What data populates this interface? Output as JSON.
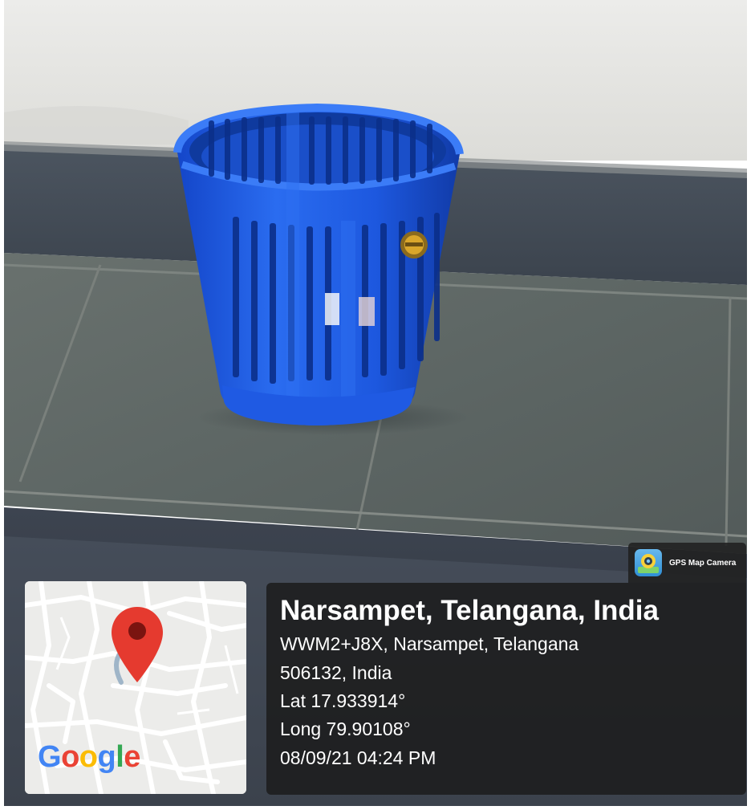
{
  "overlay": {
    "badge_label": "GPS Map Camera",
    "badge_icon": "gps-map-camera-app-icon",
    "title": "Narsampet, Telangana, India",
    "address_line_1": "WWM2+J8X, Narsampet, Telangana",
    "address_line_2": "506132, India",
    "latitude": "Lat 17.933914°",
    "longitude": "Long 79.90108°",
    "datetime": "08/09/21 04:24 PM"
  },
  "map": {
    "logo_letters": [
      {
        "char": "G",
        "color": "#4285F4"
      },
      {
        "char": "o",
        "color": "#EA4335"
      },
      {
        "char": "o",
        "color": "#FBBC05"
      },
      {
        "char": "g",
        "color": "#4285F4"
      },
      {
        "char": "l",
        "color": "#34A853"
      },
      {
        "char": "e",
        "color": "#EA4335"
      }
    ],
    "pin_icon": "map-location-pin-icon",
    "pin_color": "#E53A2F"
  },
  "scene": {
    "description_tag": "blue plastic waste-paper basket on a grey tiled floor against a white wall",
    "basket_color": "#1f5fe3",
    "wall_color": "#e8e8e4",
    "floor_color": "#5c6563"
  }
}
